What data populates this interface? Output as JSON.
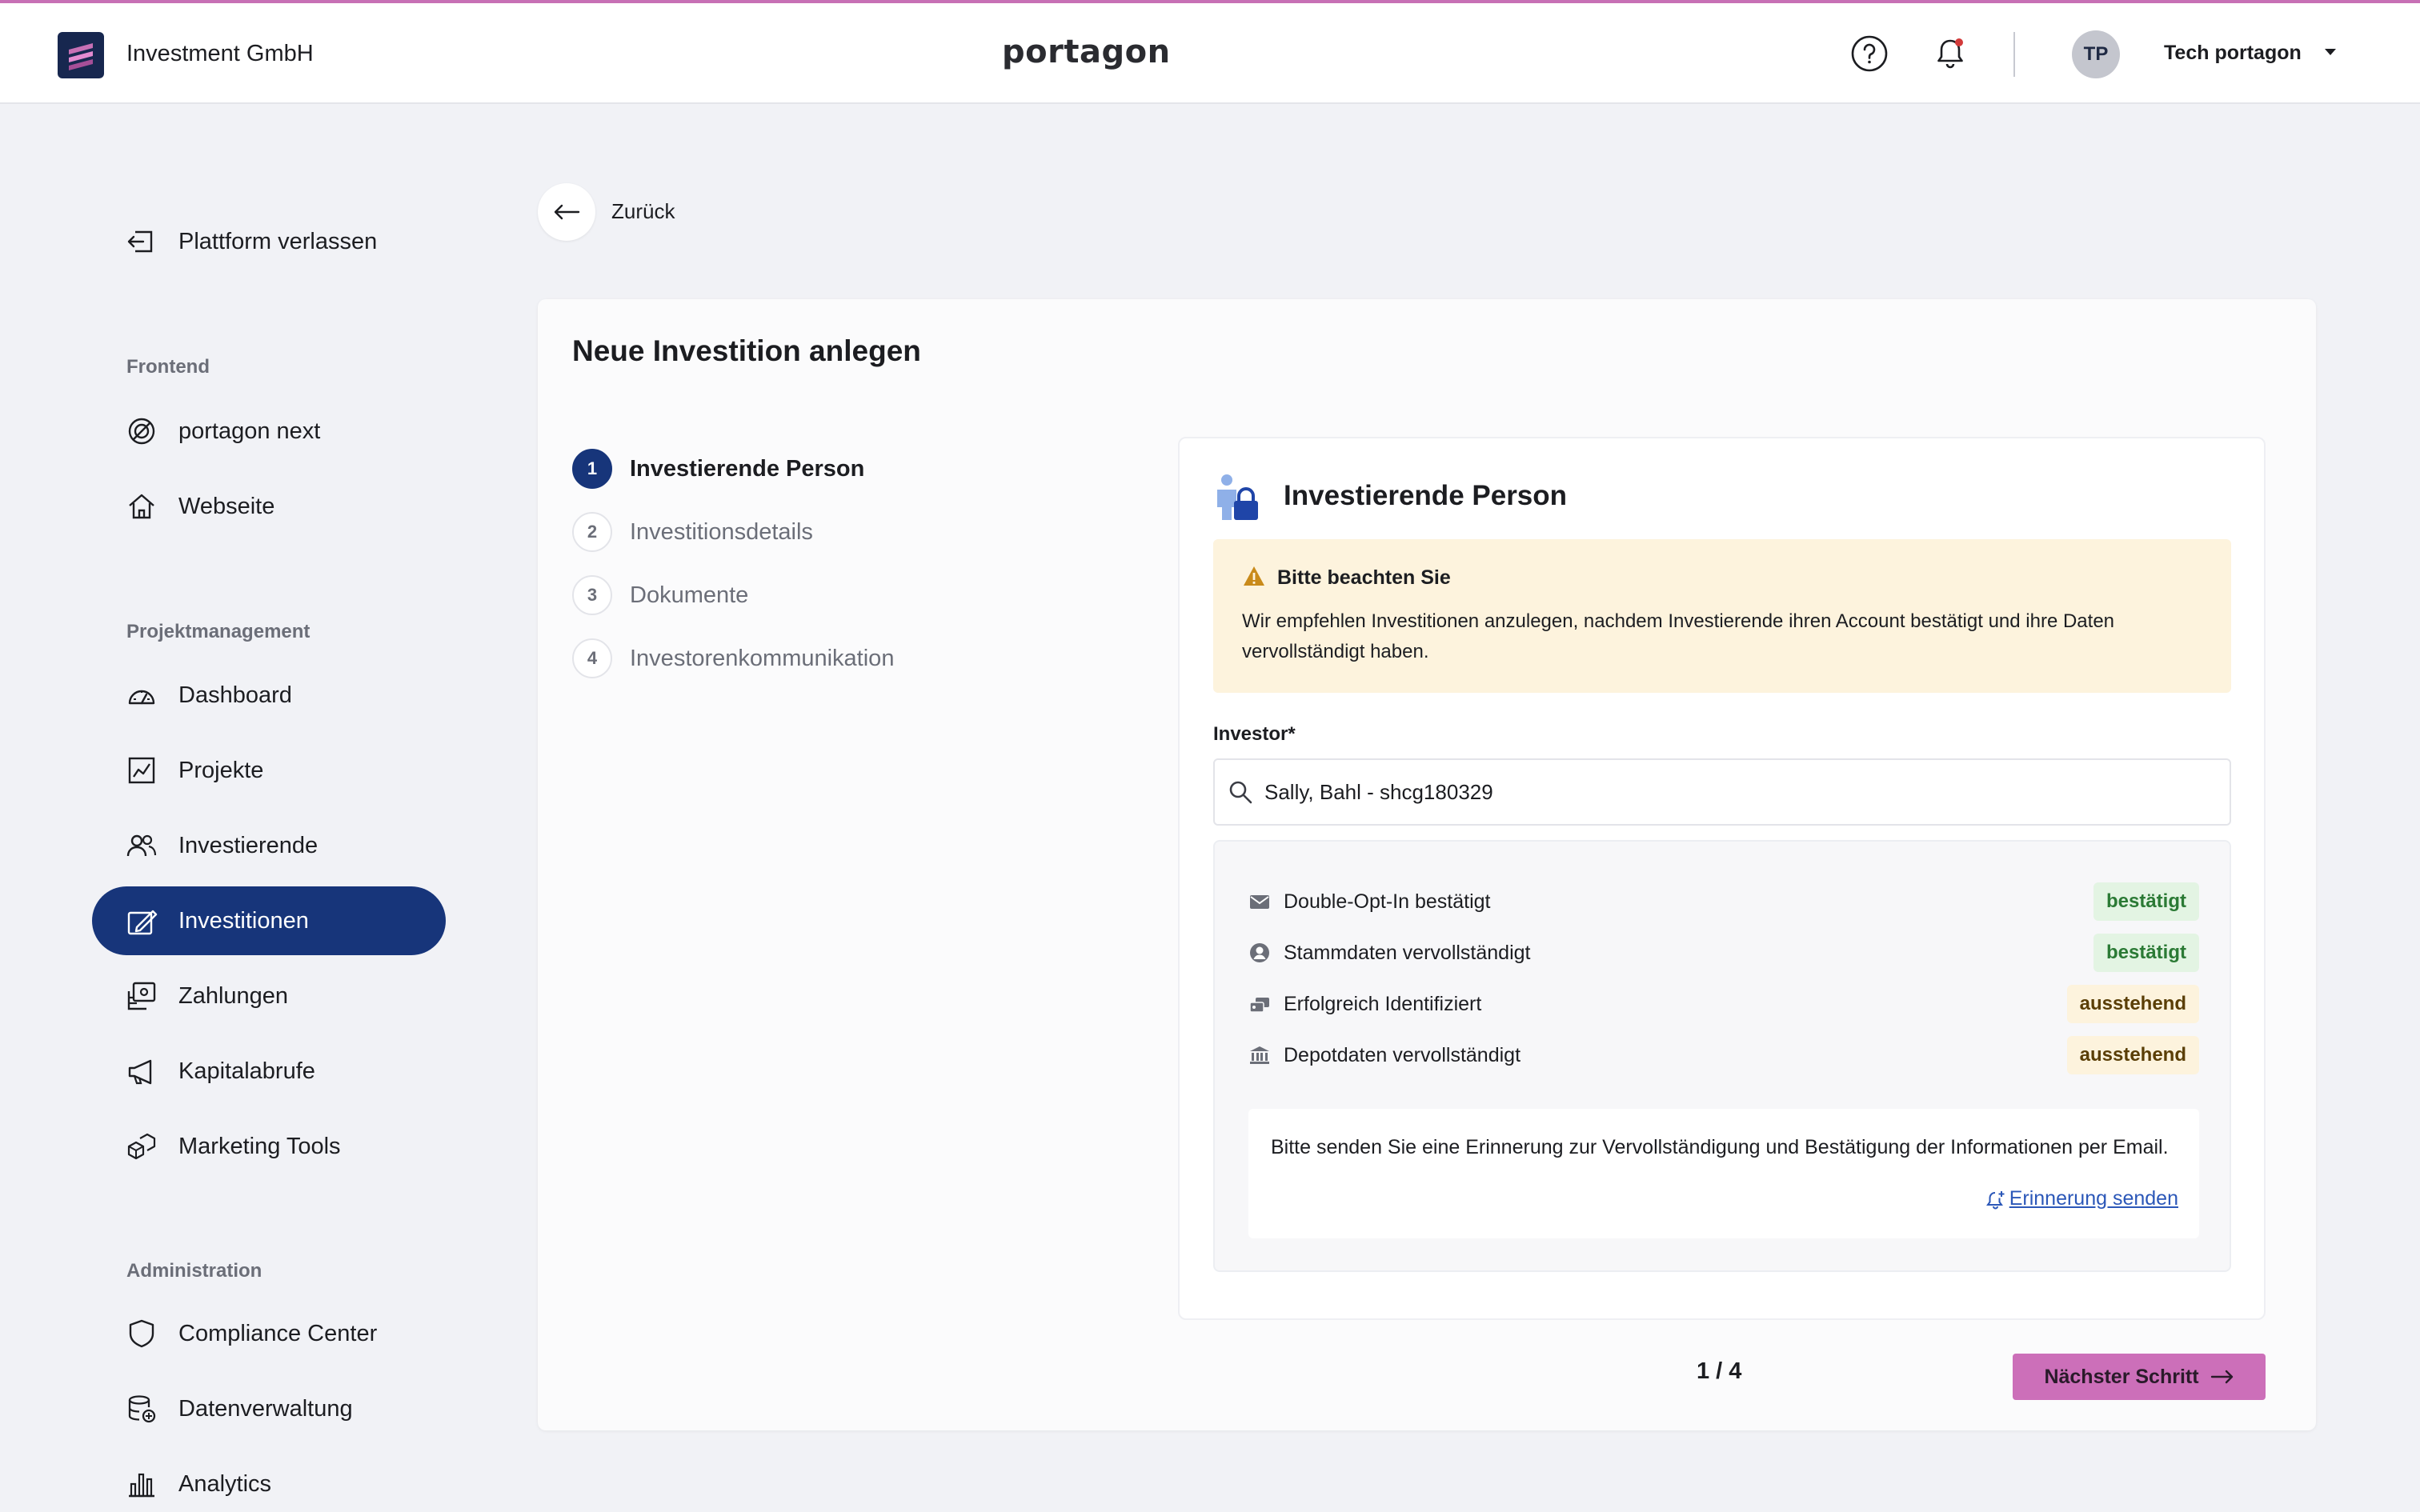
{
  "header": {
    "brand_name": "Investment GmbH",
    "center_logo": "portagon",
    "user_initials": "TP",
    "user_name": "Tech portagon"
  },
  "sidebar": {
    "leave_platform": "Plattform verlassen",
    "sections": [
      {
        "title": "Frontend",
        "items": [
          {
            "label": "portagon next",
            "icon": "portagon-next-icon"
          },
          {
            "label": "Webseite",
            "icon": "home-icon"
          }
        ]
      },
      {
        "title": "Projektmanagement",
        "items": [
          {
            "label": "Dashboard",
            "icon": "speedometer-icon"
          },
          {
            "label": "Projekte",
            "icon": "chart-icon"
          },
          {
            "label": "Investierende",
            "icon": "users-icon"
          },
          {
            "label": "Investitionen",
            "icon": "sign-icon",
            "active": true
          },
          {
            "label": "Zahlungen",
            "icon": "payments-icon"
          },
          {
            "label": "Kapitalabrufe",
            "icon": "megaphone-icon"
          },
          {
            "label": "Marketing Tools",
            "icon": "boxes-icon"
          }
        ]
      },
      {
        "title": "Administration",
        "items": [
          {
            "label": "Compliance Center",
            "icon": "shield-icon"
          },
          {
            "label": "Datenverwaltung",
            "icon": "database-icon"
          },
          {
            "label": "Analytics",
            "icon": "bar-chart-icon"
          }
        ]
      }
    ]
  },
  "back": {
    "label": "Zurück"
  },
  "main": {
    "title": "Neue Investition anlegen",
    "steps": [
      {
        "num": "1",
        "label": "Investierende Person",
        "active": true
      },
      {
        "num": "2",
        "label": "Investitionsdetails"
      },
      {
        "num": "3",
        "label": "Dokumente"
      },
      {
        "num": "4",
        "label": "Investorenkommunikation"
      }
    ],
    "panel": {
      "title": "Investierende Person",
      "notice": {
        "title": "Bitte beachten Sie",
        "text": "Wir empfehlen Investitionen anzulegen, nachdem Investierende ihren Account bestätigt und ihre Daten vervollständigt haben."
      },
      "investor_label": "Investor*",
      "investor_value": "Sally, Bahl - shcg180329",
      "status_rows": [
        {
          "label": "Double-Opt-In bestätigt",
          "status": "bestätigt",
          "state": "ok",
          "icon": "mail-icon"
        },
        {
          "label": "Stammdaten vervollständigt",
          "status": "bestätigt",
          "state": "ok",
          "icon": "user-circle-icon"
        },
        {
          "label": "Erfolgreich Identifiziert",
          "status": "ausstehend",
          "state": "pending",
          "icon": "id-card-icon"
        },
        {
          "label": "Depotdaten vervollständigt",
          "status": "ausstehend",
          "state": "pending",
          "icon": "bank-icon"
        }
      ],
      "reminder_text": "Bitte senden Sie eine Erinnerung zur Vervollständigung und Bestätigung der Informationen per Email.",
      "reminder_link": "Erinnerung senden"
    },
    "pager": "1 / 4",
    "next_button": "Nächster Schritt"
  },
  "colors": {
    "accent": "#cc6fb9",
    "primary": "#17357a",
    "badge_ok_bg": "#e3f4e3",
    "badge_pending_bg": "#fdf3dd"
  }
}
